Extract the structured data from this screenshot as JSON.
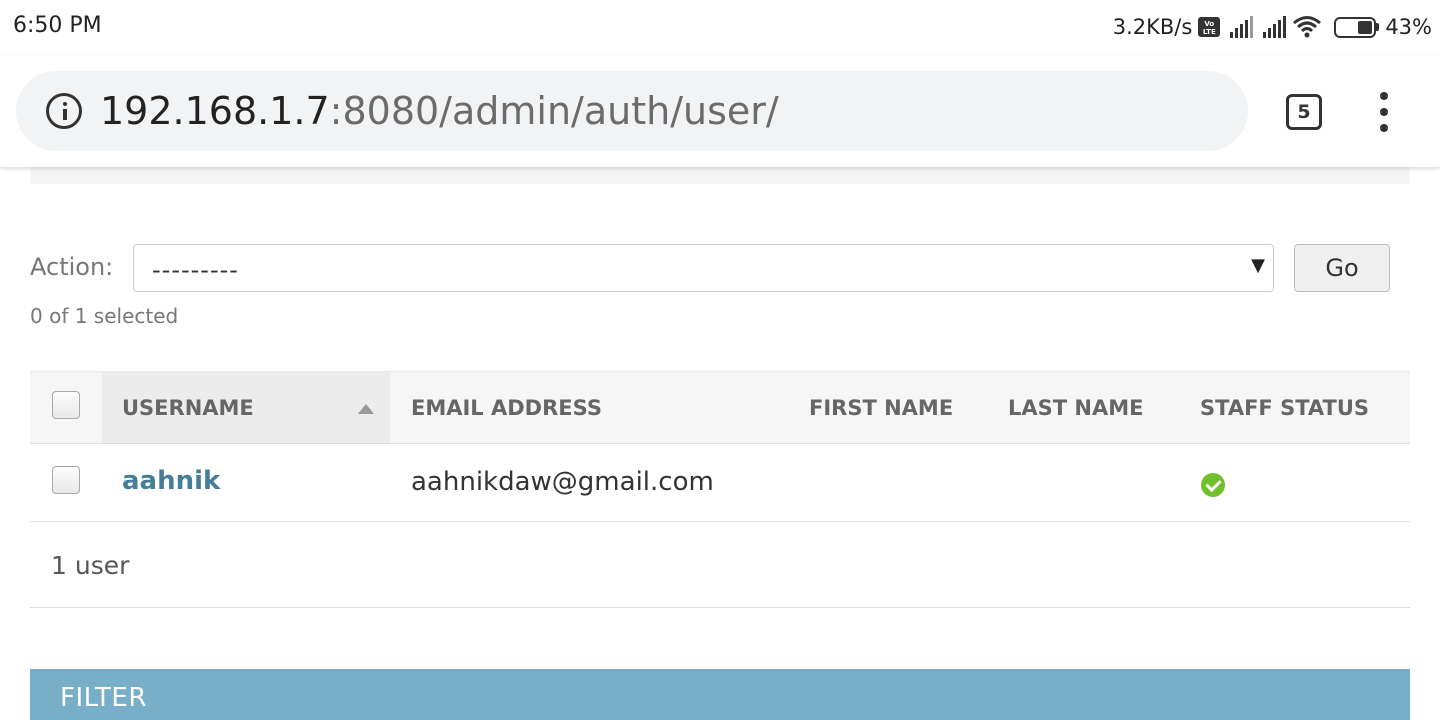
{
  "status_bar": {
    "time": "6:50 PM",
    "net_speed": "3.2KB/s",
    "volte_icon": "volte-icon",
    "wifi_icon": "wifi-icon",
    "battery": "43%"
  },
  "browser": {
    "url_host": "192.168.1.7",
    "url_rest": ":8080/admin/auth/user/",
    "tab_count": "5"
  },
  "actions": {
    "label": "Action:",
    "selected_value": "---------",
    "go_label": "Go",
    "selection_status": "0 of 1 selected"
  },
  "table": {
    "columns": [
      "USERNAME",
      "EMAIL ADDRESS",
      "FIRST NAME",
      "LAST NAME",
      "STAFF STATUS"
    ],
    "sorted_column": "USERNAME",
    "rows": [
      {
        "username": "aahnik",
        "email": "aahnikdaw@gmail.com",
        "first_name": "",
        "last_name": "",
        "staff_status": true
      }
    ],
    "result_count": "1 user"
  },
  "filter": {
    "title": "FILTER"
  },
  "colors": {
    "link": "#447e9b",
    "filter_header": "#79aec8",
    "success": "#70bf2b"
  }
}
